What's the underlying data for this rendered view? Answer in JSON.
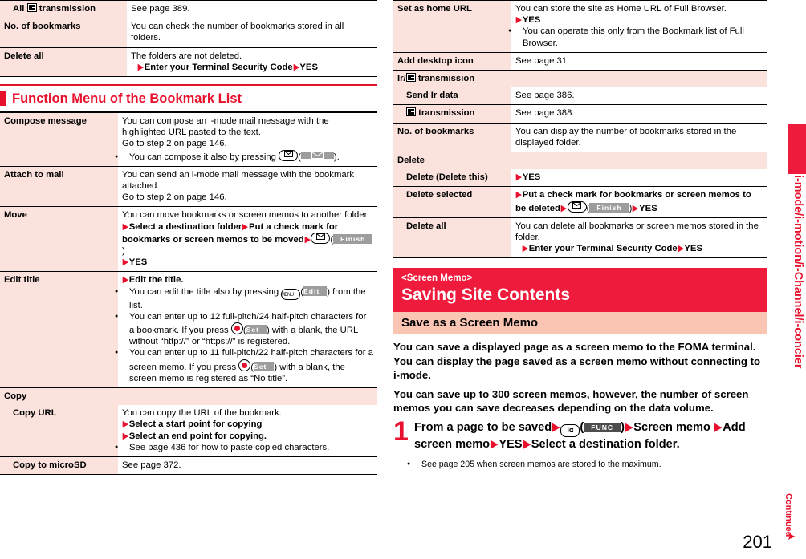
{
  "left_column": {
    "top_table": {
      "rows": [
        {
          "label_prefix": "All",
          "label_icon": "ic-transmission-icon",
          "label_suffix": "transmission",
          "indent": true,
          "desc": [
            {
              "t": "See page 389."
            }
          ]
        },
        {
          "label": "No. of bookmarks",
          "indent": false,
          "desc": [
            {
              "t": "You can check the number of bookmarks stored in all folders."
            }
          ]
        },
        {
          "label": "Delete all",
          "indent": false,
          "desc": [
            {
              "t": "The folders are not deleted."
            },
            {
              "arrow": true,
              "b": "Enter your Terminal Security Code",
              "arrow2": true,
              "b2": "YES"
            }
          ]
        }
      ]
    },
    "heading": "Function Menu of the Bookmark List",
    "rows": [
      {
        "label": "Compose message",
        "lines": [
          {
            "t": "You can compose an i-mode mail message with the highlighted URL pasted to the text."
          },
          {
            "t": "Go to step 2 on page 146."
          },
          {
            "bullet": true,
            "t": "You can compose it also by pressing ",
            "key": "mail-key",
            "softkey": "envelope",
            "tail": ")."
          }
        ]
      },
      {
        "label": "Attach to mail",
        "lines": [
          {
            "t": "You can send an i-mode mail message with the bookmark attached."
          },
          {
            "t": "Go to step 2 on page 146."
          }
        ]
      },
      {
        "label": "Move",
        "lines": [
          {
            "t": "You can move bookmarks or screen memos to another folder."
          },
          {
            "arrow": true,
            "b": "Select a destination folder",
            "arrow2": true,
            "b2": "Put a check mark for bookmarks or screen memos to be moved",
            "arrow3": true,
            "key": "mail-key",
            "softkey": "Finish",
            "tail": ")"
          },
          {
            "arrow": true,
            "b": "YES"
          }
        ]
      },
      {
        "label": "Edit title",
        "lines": [
          {
            "arrow": true,
            "b": "Edit the title."
          },
          {
            "bullet": true,
            "t": "You can edit the title also by pressing ",
            "key": "menu-key",
            "softkey": "Edit",
            "tail": ") from the list."
          },
          {
            "bullet": true,
            "t": "You can enter up to 12 full-pitch/24 half-pitch characters for a bookmark. If you press ",
            "key": "center-key",
            "softkey": "Set",
            "tail": ") with a blank, the URL without “http://” or “https://” is registered."
          },
          {
            "bullet": true,
            "t": "You can enter up to 11 full-pitch/22 half-pitch characters for a screen memo. If you press ",
            "key": "center-key",
            "softkey": "Set",
            "tail": ") with a blank, the screen memo is registered as “No title”."
          }
        ]
      }
    ],
    "copy_section": {
      "title": "Copy",
      "rows": [
        {
          "label": "Copy URL",
          "lines": [
            {
              "t": "You can copy the URL of the bookmark."
            },
            {
              "arrow": true,
              "b": "Select a start point for copying"
            },
            {
              "arrow": true,
              "b": "Select an end point for copying."
            },
            {
              "bullet": true,
              "t": "See page 436 for how to paste copied characters."
            }
          ]
        },
        {
          "label": "Copy to microSD",
          "lines": [
            {
              "t": "See page 372."
            }
          ]
        }
      ]
    }
  },
  "right_column": {
    "rows": [
      {
        "label": "Set as home URL",
        "lines": [
          {
            "t": "You can store the site as Home URL of Full Browser."
          },
          {
            "arrow": true,
            "b": "YES"
          },
          {
            "bullet": true,
            "t": "You can operate this only from the Bookmark list of Full Browser."
          }
        ]
      },
      {
        "label": "Add desktop icon",
        "lines": [
          {
            "t": "See page 31."
          }
        ]
      }
    ],
    "ir_section": {
      "title_prefix": "Ir/",
      "title_icon": "ic-transmission-icon",
      "title_suffix": "transmission",
      "rows": [
        {
          "label": "Send Ir data",
          "lines": [
            {
              "t": "See page 386."
            }
          ]
        },
        {
          "label_icon": "ic-transmission-icon",
          "label_suffix": "transmission",
          "lines": [
            {
              "t": "See page 388."
            }
          ]
        }
      ]
    },
    "rows2": [
      {
        "label": "No. of bookmarks",
        "lines": [
          {
            "t": "You can display the number of bookmarks stored in the displayed folder."
          }
        ]
      }
    ],
    "delete_section": {
      "title": "Delete",
      "rows": [
        {
          "label": "Delete (Delete this)",
          "lines": [
            {
              "arrow": true,
              "b": "YES"
            }
          ]
        },
        {
          "label": "Delete selected",
          "lines": [
            {
              "arrow": true,
              "b": "Put a check mark for bookmarks or screen memos to be deleted",
              "arrow3": true,
              "key": "mail-key",
              "softkey": "Finish",
              "tail": ")",
              "arrow2": true,
              "b2": "YES"
            }
          ]
        },
        {
          "label": "Delete all",
          "lines": [
            {
              "t": "You can delete all bookmarks or screen memos stored in the folder."
            },
            {
              "arrow": true,
              "b": "Enter your Terminal Security Code",
              "arrow2": true,
              "b2": "YES"
            }
          ]
        }
      ]
    },
    "band": {
      "small": "<Screen Memo>",
      "big": "Saving Site Contents"
    },
    "subband": "Save as a Screen Memo",
    "body_paragraphs": [
      "You can save a displayed page as a screen memo to the FOMA terminal. You can display the page saved as a screen memo without connecting to i-mode.",
      "You can save up to 300 screen memos, however, the number of screen memos you can save decreases depending on the data volume."
    ],
    "step": {
      "number": "1",
      "text_a": "From a page to be saved",
      "key": "imode-key",
      "softkey": "FUNC",
      "text_b": "Screen memo",
      "text_c": "Add screen memo",
      "text_d": "YES",
      "text_e": "Select a destination folder.",
      "note": "See page 205 when screen memos are stored to the maximum."
    }
  },
  "side_tab": {
    "label": "i-mode/i-motion/i-Channel/i-concier"
  },
  "footer": {
    "continued": "Continued",
    "page_number": "201"
  },
  "colors": {
    "red": "#e8112d",
    "band_red": "#ee1b3c",
    "pink_cell": "#fbe2dc",
    "subband_pink": "#fbc5b4"
  }
}
